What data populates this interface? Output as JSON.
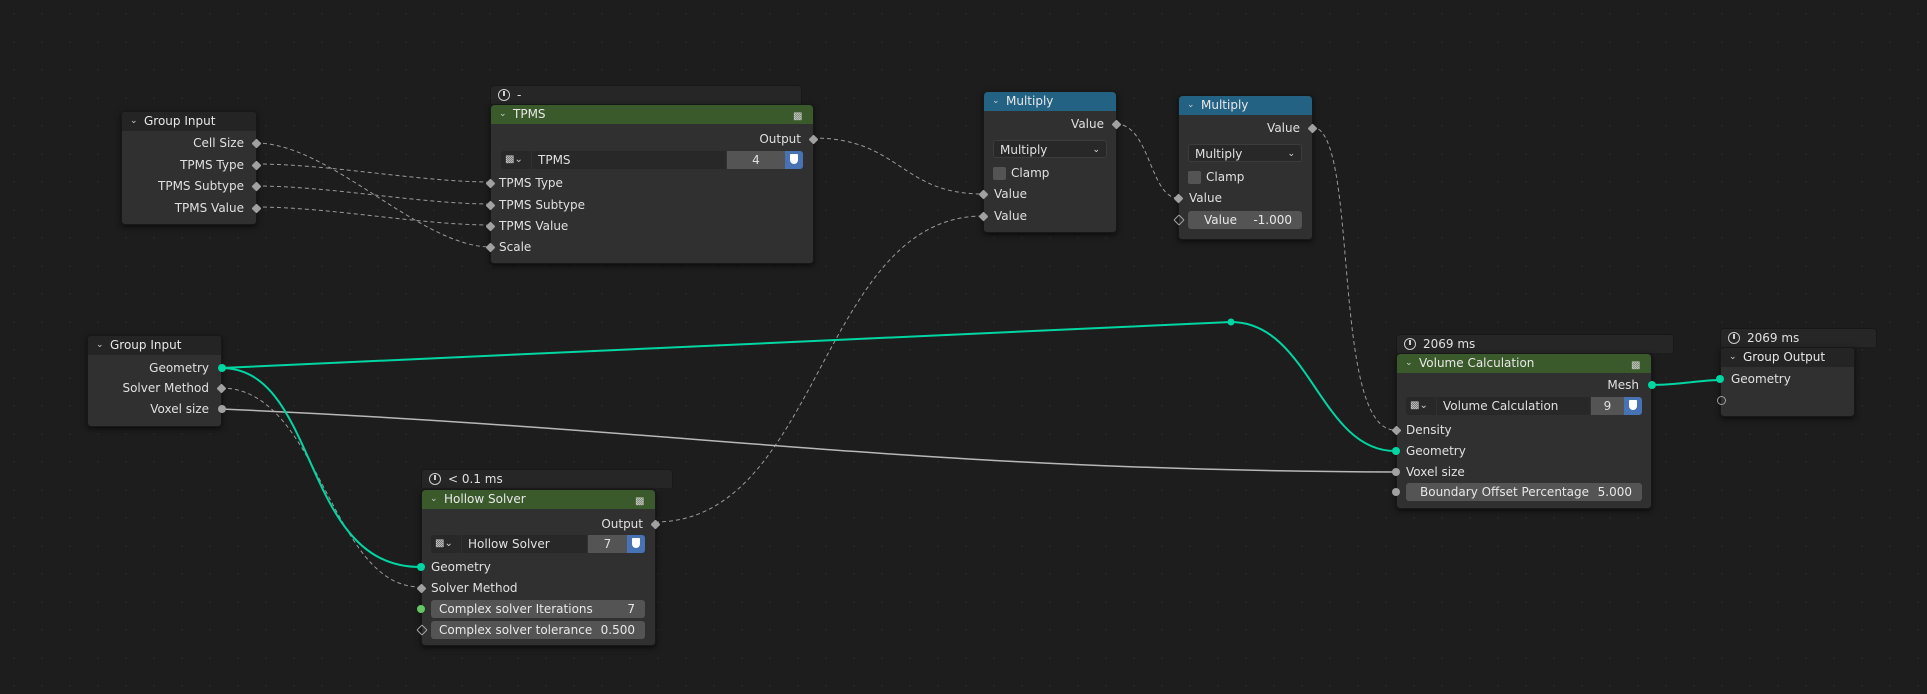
{
  "colors": {
    "background": "#1d1d1d",
    "node_body": "#303030",
    "header_group": "#242424",
    "header_geometry_group": "#3b5a2b",
    "header_math": "#246283",
    "socket_geometry": "#00d6a3",
    "socket_value": "#a1a1a1",
    "socket_integer": "#63c763",
    "link_geometry": "#00d6a3",
    "link_value": "#9a9a9a",
    "shield_blue": "#4772b3"
  },
  "group_input_1": {
    "title": "Group Input",
    "outputs": [
      "Cell Size",
      "TPMS Type",
      "TPMS Subtype",
      "TPMS Value"
    ]
  },
  "tpms": {
    "timing": "-",
    "title": "TPMS",
    "output": "Output",
    "group_name": "TPMS",
    "user_count": "4",
    "inputs": [
      "TPMS Type",
      "TPMS Subtype",
      "TPMS Value",
      "Scale"
    ]
  },
  "multiply_1": {
    "title": "Multiply",
    "output": "Value",
    "operation": "Multiply",
    "clamp": "Clamp",
    "inputs": [
      "Value",
      "Value"
    ]
  },
  "multiply_2": {
    "title": "Multiply",
    "output": "Value",
    "operation": "Multiply",
    "clamp": "Clamp",
    "input": "Value",
    "field_label": "Value",
    "field_value": "-1.000"
  },
  "group_input_2": {
    "title": "Group Input",
    "outputs": [
      "Geometry",
      "Solver Method",
      "Voxel size"
    ]
  },
  "hollow_solver": {
    "timing": "< 0.1 ms",
    "title": "Hollow Solver",
    "output": "Output",
    "group_name": "Hollow Solver",
    "user_count": "7",
    "inputs": [
      "Geometry",
      "Solver Method"
    ],
    "iterations_label": "Complex solver Iterations",
    "iterations_value": "7",
    "tolerance_label": "Complex solver tolerance",
    "tolerance_value": "0.500"
  },
  "volume_calc": {
    "timing": "2069 ms",
    "title": "Volume Calculation",
    "output": "Mesh",
    "group_name": "Volume Calculation",
    "user_count": "9",
    "inputs": [
      "Density",
      "Geometry",
      "Voxel size"
    ],
    "boundary_label": "Boundary Offset Percentage",
    "boundary_value": "5.000"
  },
  "group_output": {
    "timing": "2069 ms",
    "title": "Group Output",
    "input": "Geometry"
  }
}
